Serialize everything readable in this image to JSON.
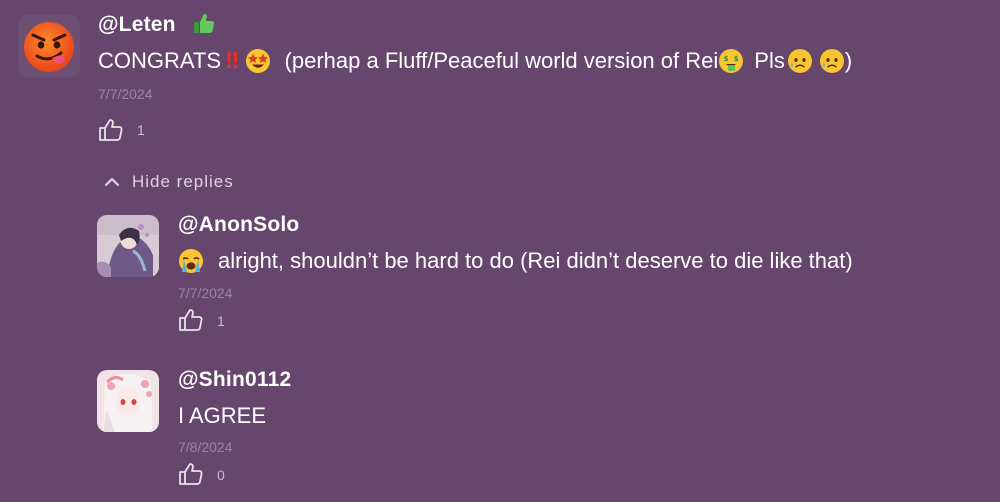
{
  "comments": [
    {
      "username": "@Leten",
      "text_parts": {
        "part1": "CONGRATS",
        "bang": "‼",
        "part2": "(perhap a Fluff/Peaceful world version of Rei",
        "part3": "Pls",
        "part4": ")"
      },
      "date": "7/7/2024",
      "likes": "1",
      "avatar_icon": "devil-tongue-emoji"
    }
  ],
  "hide_replies_label": "Hide replies",
  "replies": [
    {
      "username": "@AnonSolo",
      "text": "alright, shouldn’t be hard to do (Rei didn’t deserve to die like that)",
      "date": "7/7/2024",
      "likes": "1"
    },
    {
      "username": "@Shin0112",
      "text": "I AGREE",
      "date": "7/8/2024",
      "likes": "0"
    }
  ],
  "colors": {
    "background": "#66466c",
    "date": "#9b85a0",
    "like_count": "#c9bccd",
    "bang": "#e4302c"
  }
}
